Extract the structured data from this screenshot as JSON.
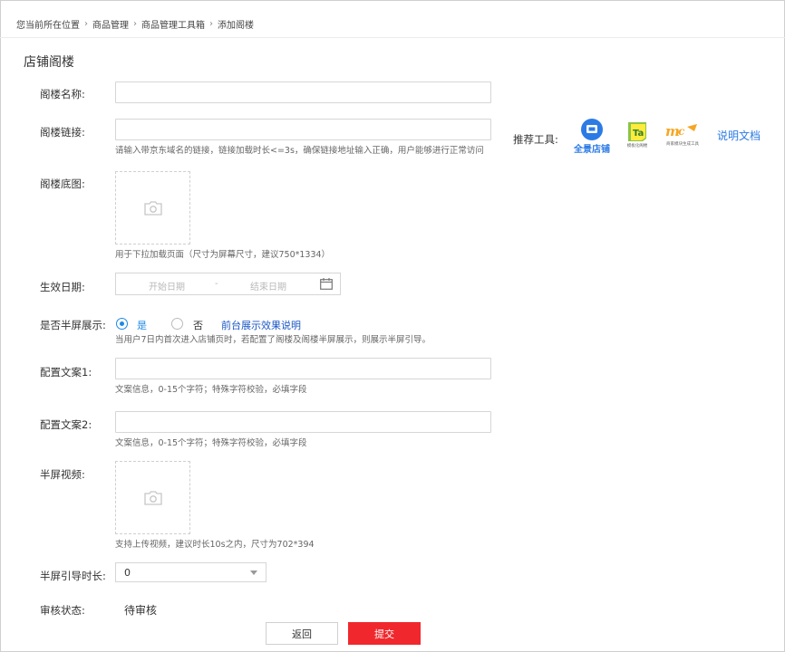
{
  "breadcrumb": {
    "items": [
      "您当前所在位置",
      "商品管理",
      "商品管理工具箱",
      "添加阁楼"
    ],
    "separator": "›"
  },
  "page": {
    "title": "店铺阁楼"
  },
  "form": {
    "name": {
      "label": "阁楼名称:",
      "value": ""
    },
    "link": {
      "label": "阁楼链接:",
      "value": "",
      "hint": "请输入带京东域名的链接，链接加载时长<=3s，确保链接地址输入正确，用户能够进行正常访问"
    },
    "tools": {
      "label": "推荐工具:",
      "items": [
        {
          "name": "全景店铺",
          "icon": "panorama-store-icon"
        },
        {
          "name": "模板化阁楼",
          "icon": "ta-template-icon"
        },
        {
          "name": "商家模块生成工具",
          "icon": "mc-tool-icon"
        }
      ],
      "doc_link": "说明文档"
    },
    "bg": {
      "label": "阁楼底图:",
      "hint": "用于下拉加载页面（尺寸为屏幕尺寸，建议750*1334）"
    },
    "date": {
      "label": "生效日期:",
      "start_placeholder": "开始日期",
      "divider": "-",
      "end_placeholder": "结束日期"
    },
    "halfscreen": {
      "label": "是否半屏展示:",
      "yes": "是",
      "no": "否",
      "selected": "是",
      "effect_link": "前台展示效果说明",
      "hint": "当用户7日内首次进入店铺页时，若配置了阁楼及阁楼半屏展示，则展示半屏引导。"
    },
    "copy1": {
      "label": "配置文案1:",
      "value": "",
      "hint": "文案信息，0-15个字符；特殊字符校验，必填字段"
    },
    "copy2": {
      "label": "配置文案2:",
      "value": "",
      "hint": "文案信息，0-15个字符；特殊字符校验，必填字段"
    },
    "video": {
      "label": "半屏视频:",
      "hint": "支持上传视频，建议时长10s之内，尺寸为702*394"
    },
    "duration": {
      "label": "半屏引导时长:",
      "value": "0"
    },
    "status": {
      "label": "审核状态:",
      "value": "待审核"
    }
  },
  "actions": {
    "back": "返回",
    "submit": "提交"
  },
  "colors": {
    "primary": "#f0282d",
    "link": "#1a56c6",
    "radio": "#1e88e5"
  }
}
